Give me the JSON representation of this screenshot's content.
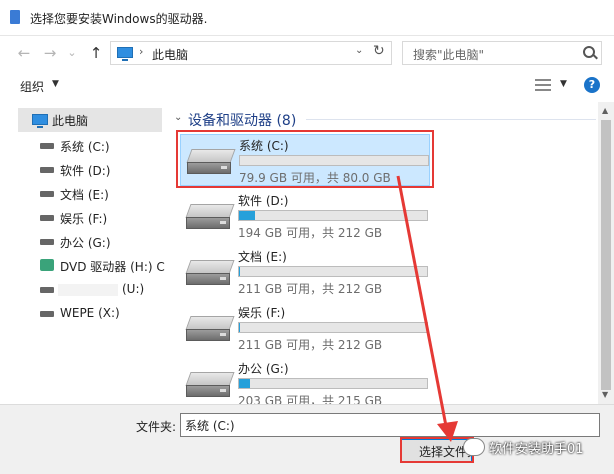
{
  "window": {
    "title": "选择您要安装Windows的驱动器."
  },
  "nav": {
    "back": "←",
    "forward": "→",
    "recent": "⌄",
    "up": "↑",
    "address_sep": "›",
    "address": "此电脑",
    "dropdown": "⌄",
    "refresh": "↻",
    "search_placeholder": "搜索\"此电脑\""
  },
  "toolbar": {
    "organize": "组织",
    "organize_caret": "▼",
    "view_caret": "▼",
    "help": "?"
  },
  "sidebar": {
    "items": [
      {
        "label": "此电脑",
        "icon": "pc-icon",
        "selected": true
      },
      {
        "label": "系统 (C:)",
        "icon": "drive-icon"
      },
      {
        "label": "软件 (D:)",
        "icon": "drive-icon"
      },
      {
        "label": "文档 (E:)",
        "icon": "drive-icon"
      },
      {
        "label": "娱乐 (F:)",
        "icon": "drive-icon"
      },
      {
        "label": "办公 (G:)",
        "icon": "drive-icon"
      },
      {
        "label": "DVD 驱动器 (H:) C",
        "icon": "dvd-icon"
      },
      {
        "label": "(U:)",
        "icon": "drive-icon"
      },
      {
        "label": "WEPE (X:)",
        "icon": "drive-icon"
      }
    ]
  },
  "content": {
    "group_chevron": "⌄",
    "group_title": "设备和驱动器 (8)",
    "drives": [
      {
        "name": "系统 (C:)",
        "info": "79.9 GB 可用，共 80.0 GB",
        "used_fraction": 0.0,
        "selected": true
      },
      {
        "name": "软件 (D:)",
        "info": "194 GB 可用，共 212 GB",
        "used_fraction": 0.085
      },
      {
        "name": "文档 (E:)",
        "info": "211 GB 可用，共 212 GB",
        "used_fraction": 0.005
      },
      {
        "name": "娱乐 (F:)",
        "info": "211 GB 可用，共 212 GB",
        "used_fraction": 0.005
      },
      {
        "name": "办公 (G:)",
        "info": "203 GB 可用，共 215 GB",
        "used_fraction": 0.056
      }
    ]
  },
  "scroll": {
    "up": "▲",
    "down": "▼"
  },
  "footer": {
    "folder_label": "文件夹:",
    "folder_value": "系统 (C:)",
    "select_button": "选择文件夹"
  },
  "watermark": {
    "text": "软件安装助手01"
  },
  "colors": {
    "accent": "#26a0da",
    "selection": "#cce8ff",
    "annotation": "#e53935",
    "heading": "#1e3f87"
  }
}
